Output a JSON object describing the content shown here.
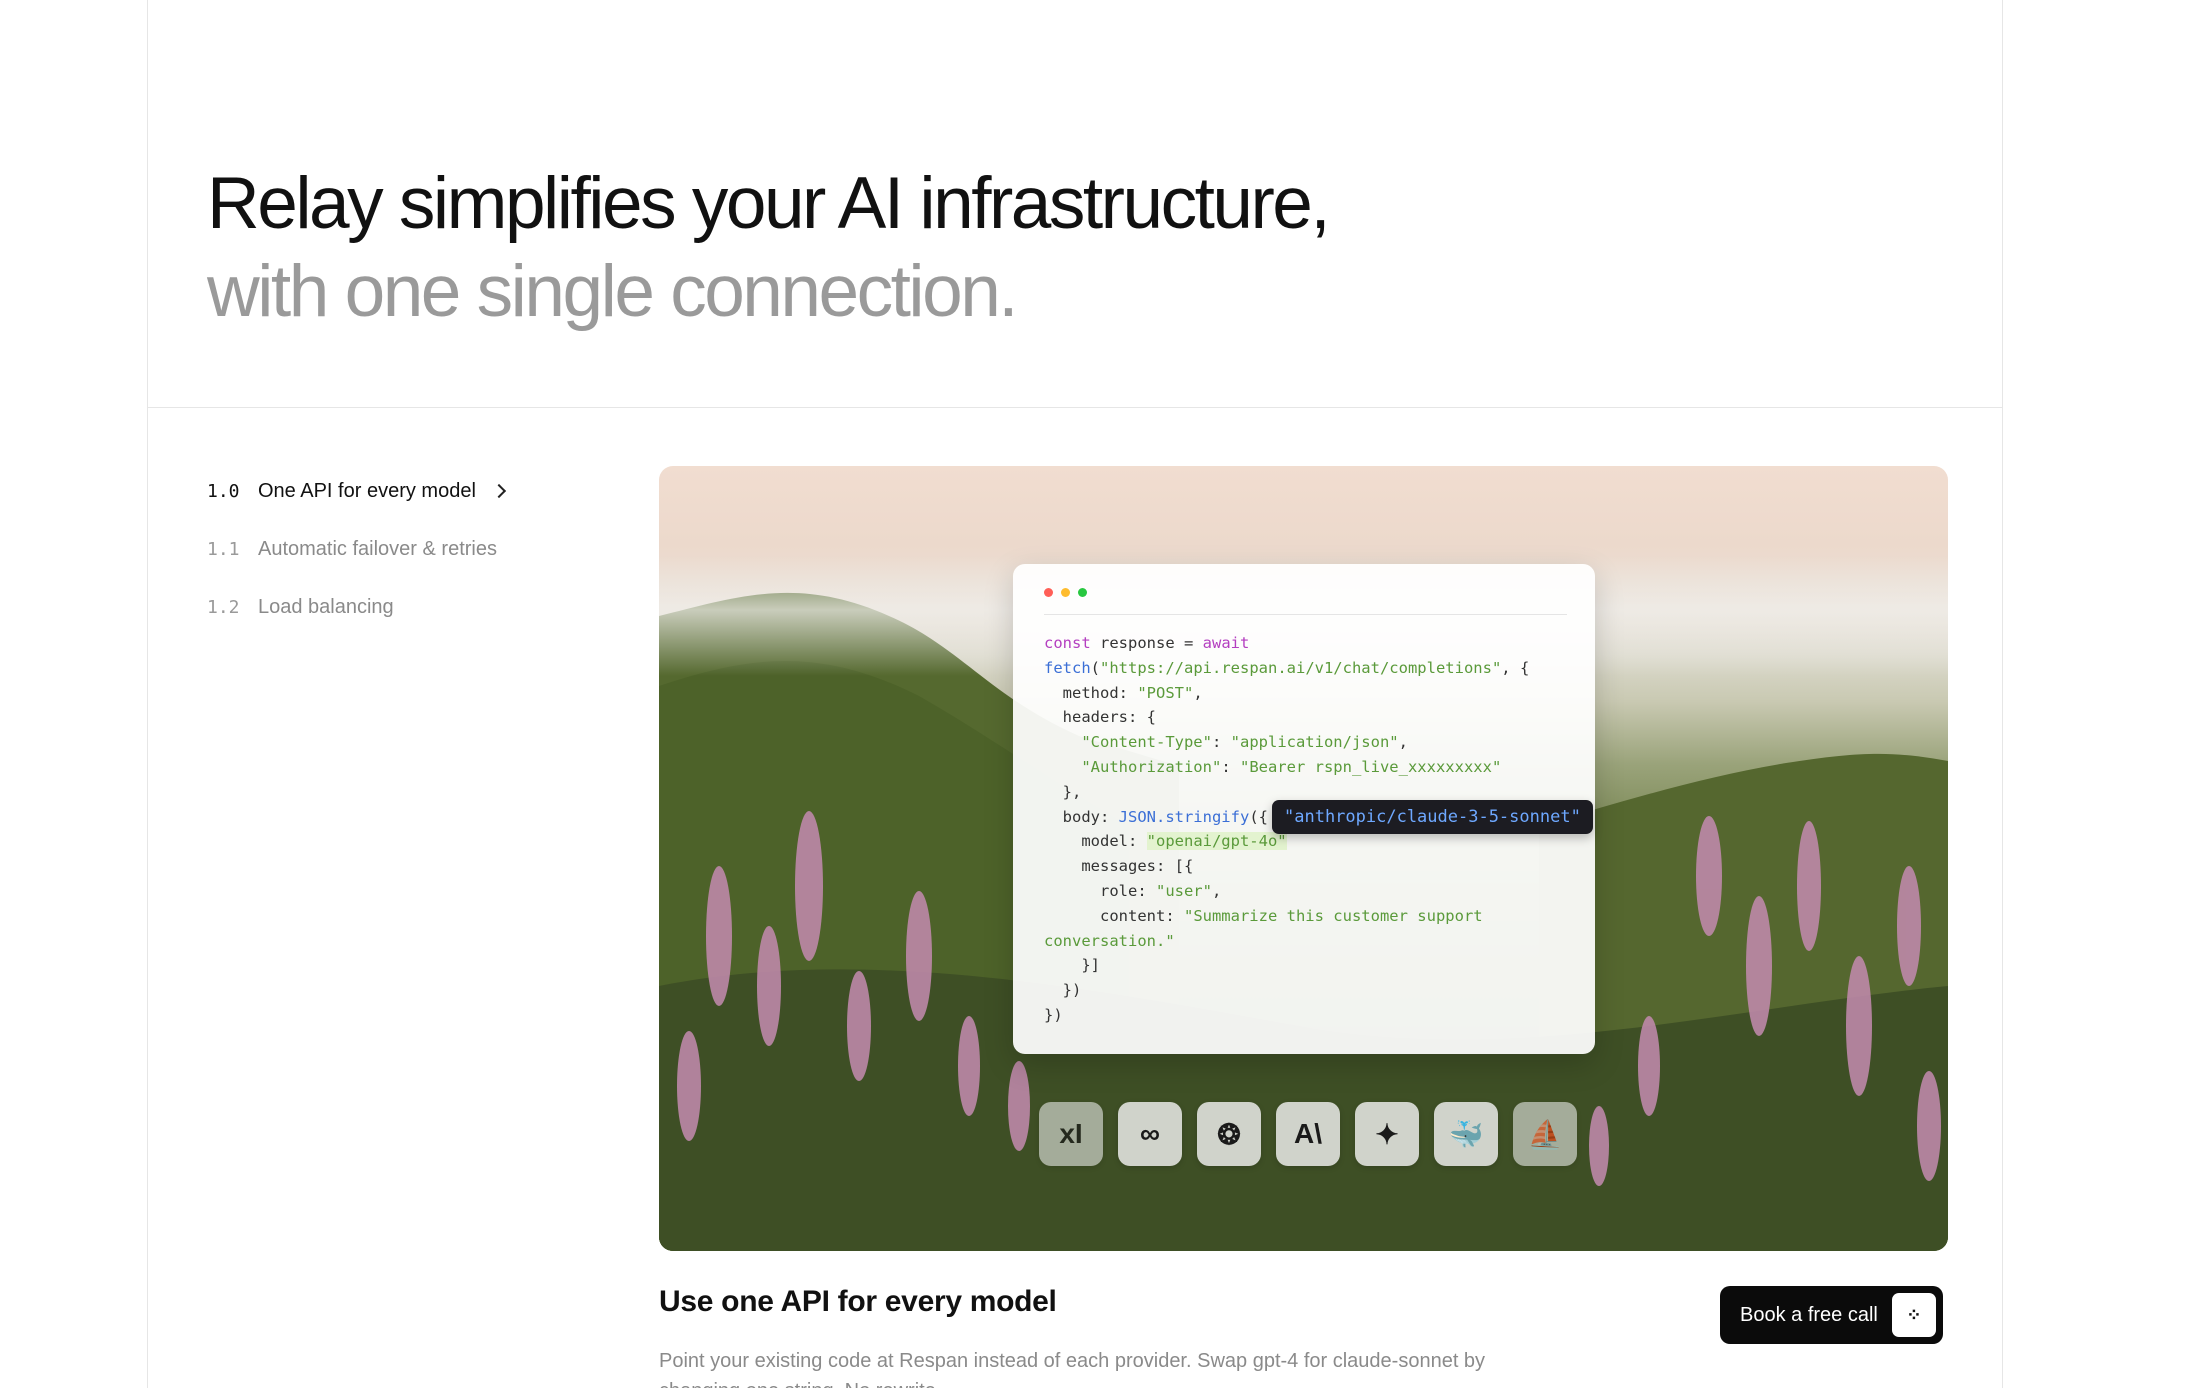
{
  "hero": {
    "title_line1": "Relay simplifies your AI infrastructure,",
    "title_line2": "with one single connection."
  },
  "steps": [
    {
      "num": "1.0",
      "label": "One API for every model",
      "active": true
    },
    {
      "num": "1.1",
      "label": "Automatic failover & retries",
      "active": false
    },
    {
      "num": "1.2",
      "label": "Load balancing",
      "active": false
    }
  ],
  "code_window": {
    "dot_colors": [
      "#ff5f57",
      "#febc2e",
      "#28c840"
    ],
    "model_tag": "\"anthropic/claude-3-5-sonnet\""
  },
  "providers": [
    {
      "name": "xai-icon",
      "glyph": "xI"
    },
    {
      "name": "meta-icon",
      "glyph": "∞"
    },
    {
      "name": "openai-icon",
      "glyph": "❂"
    },
    {
      "name": "anthropic-icon",
      "glyph": "A\\"
    },
    {
      "name": "gemini-icon",
      "glyph": "✦"
    },
    {
      "name": "deepseek-icon",
      "glyph": "🐳"
    },
    {
      "name": "mistral-icon",
      "glyph": "⛵"
    }
  ],
  "section": {
    "title": "Use one API for every model",
    "description": "Point your existing code at Respan instead of each provider. Swap gpt-4 for claude-sonnet by changing one string. No rewrite."
  },
  "cta": {
    "label": "Book a free call",
    "icon": "⁘"
  }
}
